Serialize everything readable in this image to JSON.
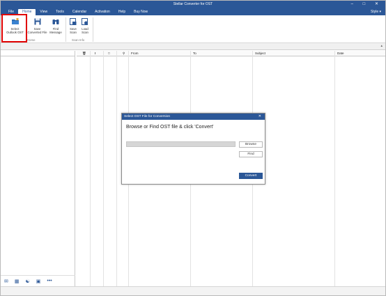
{
  "window": {
    "title": "Stellar Converter for OST",
    "controls": "– □ ✕"
  },
  "menu": {
    "items": [
      "File",
      "Home",
      "View",
      "Tools",
      "Calendar",
      "Activation",
      "Help",
      "Buy Now"
    ],
    "active": "Home",
    "style_label": "Style ▾"
  },
  "ribbon": {
    "select_outlook_ost": [
      "Select",
      "Outlook OST"
    ],
    "save_converted_file": [
      "Save",
      "Converted File"
    ],
    "find_message": [
      "Find",
      "Message"
    ],
    "save_scan": [
      "Save",
      "Scan"
    ],
    "load_scan": [
      "Load",
      "Scan"
    ],
    "group_home": "Home",
    "group_scan_info": "Scan Info"
  },
  "grid": {
    "columns": [
      "From",
      "To",
      "Subject",
      "Date"
    ]
  },
  "dialog": {
    "title": "Select OST File for Conversion",
    "heading": "Browse or Find OST file & click 'Convert'",
    "browse_label": "Browse",
    "find_label": "Find",
    "convert_label": "Convert",
    "path_value": ""
  },
  "colors": {
    "accent": "#2b5797",
    "highlight": "#e00000"
  },
  "left_icons": [
    "mail-icon",
    "calendar-icon",
    "contacts-icon",
    "tasks-icon",
    "more-icon"
  ]
}
